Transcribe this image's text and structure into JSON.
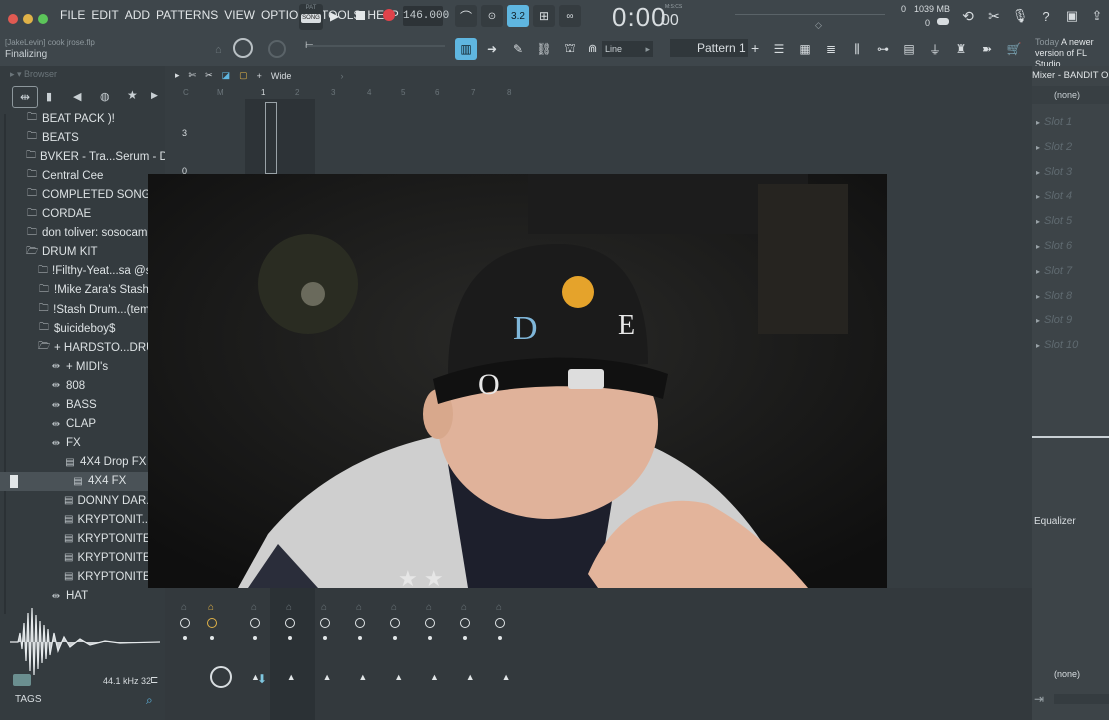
{
  "menu": [
    "FILE",
    "EDIT",
    "ADD",
    "PATTERNS",
    "VIEW",
    "OPTIONS",
    "TOOLS",
    "HELP"
  ],
  "transport": {
    "pat_label": "PAT",
    "song_label": "SONG",
    "tempo": "146.000",
    "time": "0:00",
    "time_small": "00",
    "time_unit": "M:S:CS",
    "snap": "3.2"
  },
  "status": {
    "cpu": "0",
    "memory": "1039 MB",
    "poly": "0"
  },
  "hint": {
    "title": "[JakeLevin] cook jrose.flp",
    "text": "Finalizing"
  },
  "toolbar2": {
    "line_mode": "Line",
    "pattern": "Pattern 1"
  },
  "news": {
    "line1_a": "Today",
    "line1_b": "A newer",
    "line2": "version of FL Studio"
  },
  "browser": {
    "title": "Browser",
    "items": [
      {
        "label": "BEAT PACK )!",
        "indent": 0,
        "icon": "folder"
      },
      {
        "label": "BEATS",
        "indent": 0,
        "icon": "folder"
      },
      {
        "label": "BVKER - Tra...Serum - Demo",
        "indent": 0,
        "icon": "folder"
      },
      {
        "label": "Central Cee",
        "indent": 0,
        "icon": "folder"
      },
      {
        "label": "COMPLETED SONGS",
        "indent": 0,
        "icon": "folder"
      },
      {
        "label": "CORDAE",
        "indent": 0,
        "icon": "folder"
      },
      {
        "label": "don toliver: sosocamo",
        "indent": 0,
        "icon": "folder"
      },
      {
        "label": "DRUM KIT",
        "indent": 0,
        "icon": "folder-open"
      },
      {
        "label": "!Filthy-Yeat...sa @slime",
        "indent": 1,
        "icon": "folder"
      },
      {
        "label": "!Mike Zara's Stash",
        "indent": 1,
        "icon": "folder"
      },
      {
        "label": "!Stash Drum...(templa",
        "indent": 1,
        "icon": "folder"
      },
      {
        "label": "$uicideboy$",
        "indent": 1,
        "icon": "folder"
      },
      {
        "label": "+ HARDSTO...DRUM KI",
        "indent": 1,
        "icon": "folder-open"
      },
      {
        "label": "+ MIDI's",
        "indent": 2,
        "icon": "pack"
      },
      {
        "label": "808",
        "indent": 2,
        "icon": "pack"
      },
      {
        "label": "BASS",
        "indent": 2,
        "icon": "pack"
      },
      {
        "label": "CLAP",
        "indent": 2,
        "icon": "pack"
      },
      {
        "label": "FX",
        "indent": 2,
        "icon": "pack"
      },
      {
        "label": "4X4 Drop FX",
        "indent": 3,
        "icon": "file"
      },
      {
        "label": "4X4 FX",
        "indent": 4,
        "icon": "file"
      },
      {
        "label": "DONNY DAR...(Part M",
        "indent": 3,
        "icon": "file"
      },
      {
        "label": "KRYPTONIT...(Part M",
        "indent": 3,
        "icon": "file"
      },
      {
        "label": "KRYPTONITE...amplif",
        "indent": 3,
        "icon": "file"
      },
      {
        "label": "KRYPTONITE...(Part M",
        "indent": 3,
        "icon": "file"
      },
      {
        "label": "KRYPTONITE Keys",
        "indent": 3,
        "icon": "file"
      },
      {
        "label": "HAT",
        "indent": 2,
        "icon": "pack"
      }
    ],
    "selected_index": 19,
    "sample_info": "44.1 kHz 32",
    "tags_label": "TAGS"
  },
  "playlist": {
    "mode": "Wide",
    "bar_labels": [
      "C",
      "M",
      "1",
      "2",
      "3",
      "4",
      "5",
      "6",
      "7",
      "8"
    ],
    "row_labels": [
      "3",
      "0"
    ]
  },
  "mixer": {
    "title": "Mixer - BANDIT Op",
    "input": "(none)",
    "slots": [
      "Slot 1",
      "Slot 2",
      "Slot 3",
      "Slot 4",
      "Slot 5",
      "Slot 6",
      "Slot 7",
      "Slot 8",
      "Slot 9",
      "Slot 10"
    ],
    "equalizer": "Equalizer",
    "output": "(none)"
  },
  "colors": {
    "accent": "#5fb6e0",
    "record": "#e0434b",
    "background": "#3a4146",
    "panel": "#343b3f"
  }
}
